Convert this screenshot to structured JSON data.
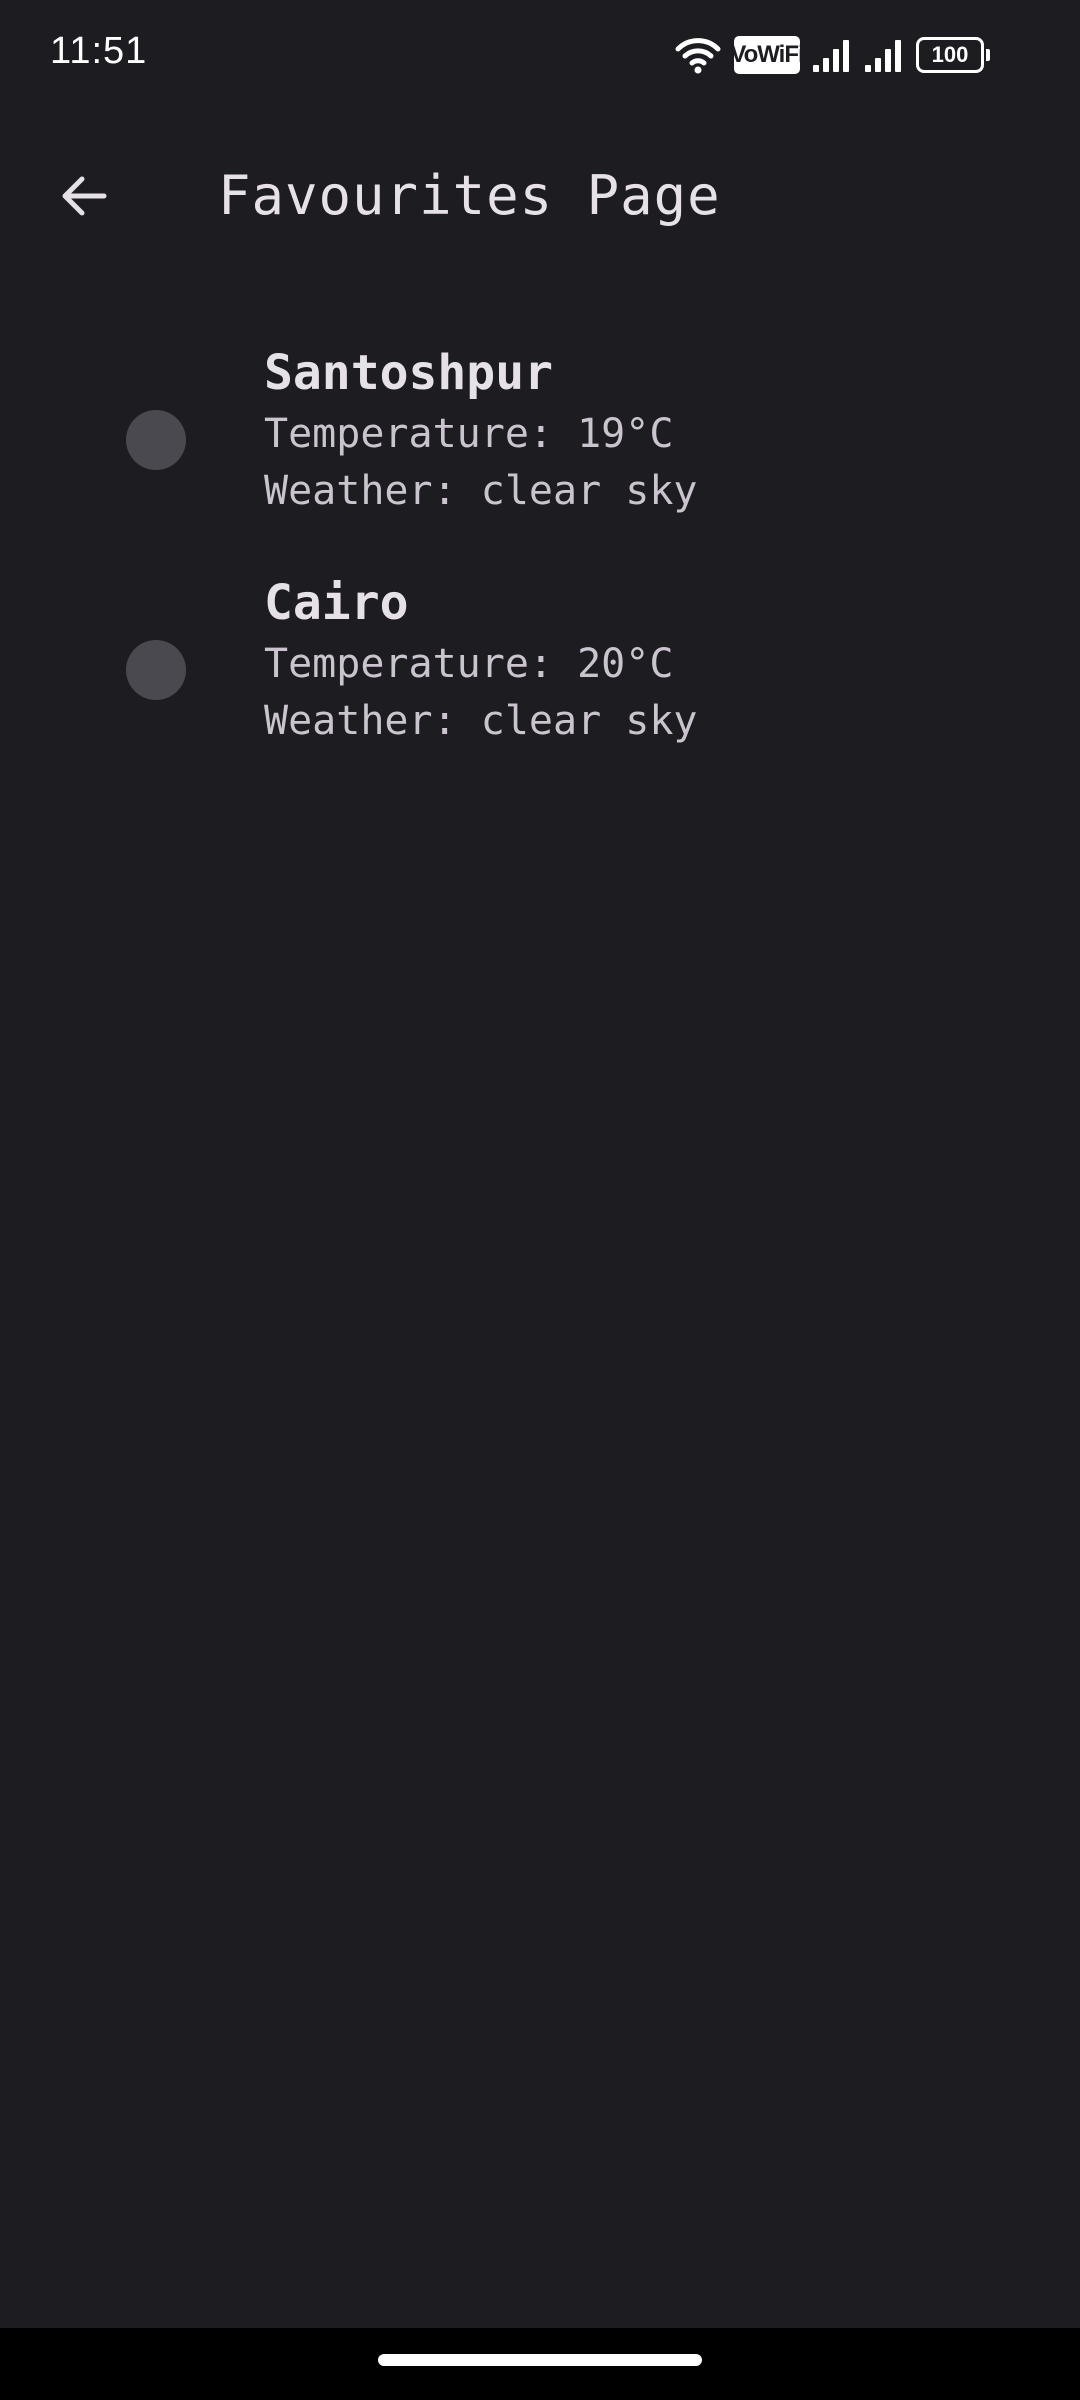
{
  "status_bar": {
    "time": "11:51",
    "vowifi_label": "VoWiFi",
    "battery_level": "100",
    "icons": [
      "wifi-icon",
      "vowifi-icon",
      "signal-icon",
      "signal-icon",
      "battery-icon"
    ]
  },
  "app_bar": {
    "back_icon": "arrow-left-icon",
    "title": "Favourites Page"
  },
  "favourites": [
    {
      "city": "Santoshpur",
      "temperature": "Temperature: 19°C",
      "weather": "Weather: clear sky",
      "selected": false
    },
    {
      "city": "Cairo",
      "temperature": "Temperature: 20°C",
      "weather": "Weather: clear sky",
      "selected": false
    }
  ],
  "colors": {
    "background": "#1d1c21",
    "text_primary": "#e6e1e6",
    "text_secondary": "#cac4cf",
    "radio": "#4a494f"
  }
}
